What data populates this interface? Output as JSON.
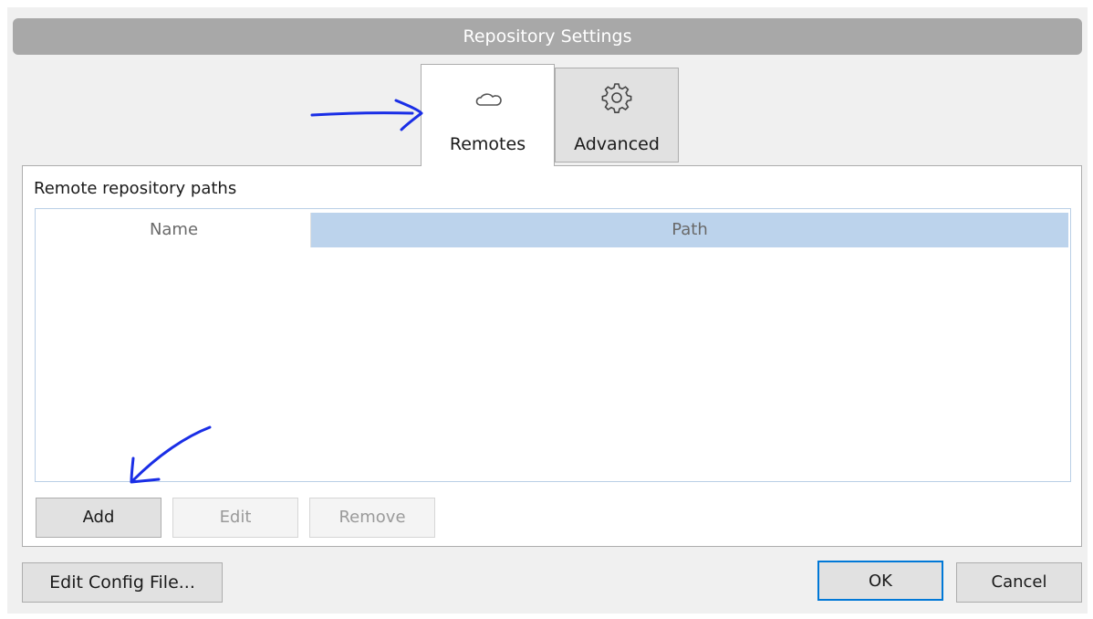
{
  "window": {
    "title": "Repository Settings"
  },
  "tabs": [
    {
      "label": "Remotes",
      "icon": "cloud-icon",
      "active": true
    },
    {
      "label": "Advanced",
      "icon": "gear-icon",
      "active": false
    }
  ],
  "remotes": {
    "section_label": "Remote repository paths",
    "columns": [
      "Name",
      "Path"
    ],
    "rows": [],
    "buttons": {
      "add": "Add",
      "edit": "Edit",
      "remove": "Remove"
    }
  },
  "footer": {
    "edit_config": "Edit Config File...",
    "ok": "OK",
    "cancel": "Cancel"
  },
  "colors": {
    "annotation": "#1a2ee6",
    "header_selected": "#bcd3ec",
    "default_button_border": "#0078d7"
  }
}
